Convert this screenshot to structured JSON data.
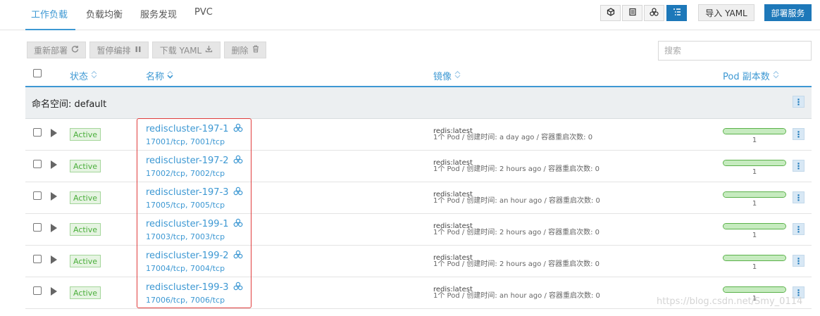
{
  "tabs": [
    {
      "label": "工作负载",
      "active": true
    },
    {
      "label": "负载均衡",
      "active": false
    },
    {
      "label": "服务发现",
      "active": false
    },
    {
      "label": "PVC",
      "active": false
    }
  ],
  "toolbar": {
    "import_label": "导入 YAML",
    "deploy_label": "部署服务",
    "view_icons": [
      "cube-icon",
      "list-icon",
      "service-icon",
      "tree-list-icon"
    ],
    "active_view": "tree-list-icon"
  },
  "actions": {
    "redeploy": "重新部署",
    "pause": "暂停编排",
    "download": "下载 YAML",
    "delete": "删除"
  },
  "search": {
    "placeholder": "搜索"
  },
  "table": {
    "headers": {
      "status": "状态",
      "name": "名称",
      "image": "镜像",
      "pods": "Pod 副本数"
    },
    "namespace_label": "命名空间: default",
    "rows": [
      {
        "status": "Active",
        "name": "rediscluster-197-1",
        "ports": "17001/tcp, 7001/tcp",
        "image": "redis:latest",
        "meta": "1个 Pod / 创建时间: a day ago / 容器重启次数: 0",
        "pods": "1",
        "ready_fraction": 1.0
      },
      {
        "status": "Active",
        "name": "rediscluster-197-2",
        "ports": "17002/tcp, 7002/tcp",
        "image": "redis:latest",
        "meta": "1个 Pod / 创建时间: 2 hours ago / 容器重启次数: 0",
        "pods": "1",
        "ready_fraction": 1.0
      },
      {
        "status": "Active",
        "name": "rediscluster-197-3",
        "ports": "17005/tcp, 7005/tcp",
        "image": "redis:latest",
        "meta": "1个 Pod / 创建时间: an hour ago / 容器重启次数: 0",
        "pods": "1",
        "ready_fraction": 1.0
      },
      {
        "status": "Active",
        "name": "rediscluster-199-1",
        "ports": "17003/tcp, 7003/tcp",
        "image": "redis:latest",
        "meta": "1个 Pod / 创建时间: 2 hours ago / 容器重启次数: 0",
        "pods": "1",
        "ready_fraction": 1.0
      },
      {
        "status": "Active",
        "name": "rediscluster-199-2",
        "ports": "17004/tcp, 7004/tcp",
        "image": "redis:latest",
        "meta": "1个 Pod / 创建时间: 2 hours ago / 容器重启次数: 0",
        "pods": "1",
        "ready_fraction": 1.0
      },
      {
        "status": "Active",
        "name": "rediscluster-199-3",
        "ports": "17006/tcp, 7006/tcp",
        "image": "redis:latest",
        "meta": "1个 Pod / 创建时间: an hour ago / 容器重启次数: 0",
        "pods": "1",
        "ready_fraction": 1.0
      }
    ]
  },
  "watermark": "https://blog.csdn.net/Smy_0114",
  "colors": {
    "accent": "#3d98d3",
    "primary_button": "#1d78b9",
    "status_active": "#4aae3b",
    "highlight": "#e03c3c"
  }
}
